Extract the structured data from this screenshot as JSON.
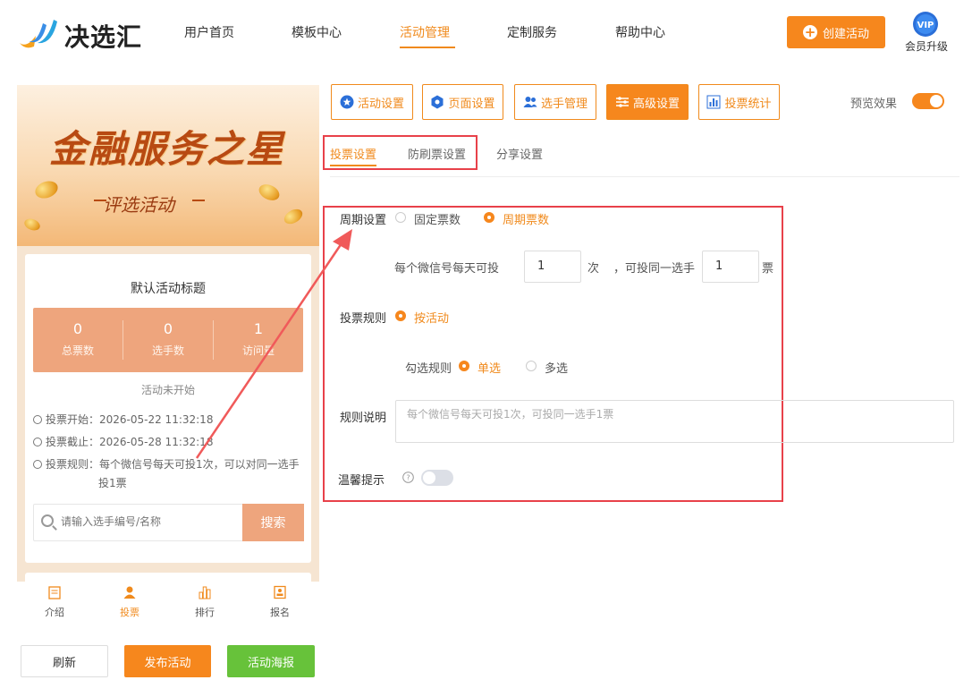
{
  "header": {
    "logo_text": "决选汇",
    "nav": [
      "用户首页",
      "模板中心",
      "活动管理",
      "定制服务",
      "帮助中心"
    ],
    "active_nav": "活动管理",
    "create_label": "创建活动",
    "vip_badge": "VIP",
    "vip_label": "会员升级",
    "accent_color": "#f6871d"
  },
  "phone": {
    "banner_title": "金融服务之星",
    "banner_sub": "评选活动",
    "card_title": "默认活动标题",
    "stats": [
      {
        "value": "0",
        "label": "总票数"
      },
      {
        "value": "0",
        "label": "选手数"
      },
      {
        "value": "1",
        "label": "访问量"
      }
    ],
    "status": "活动未开始",
    "start_line": "投票开始：2026-05-22 11:32:18",
    "end_line": "投票截止：2026-05-28 11:32:18",
    "rule_line1": "投票规则：每个微信号每天可投1次，可以对同一选手",
    "rule_line2": "投1票",
    "search_placeholder": "请输入选手编号/名称",
    "search_btn": "搜索",
    "tabbar": [
      {
        "label": "介绍",
        "icon": "doc-icon"
      },
      {
        "label": "投票",
        "icon": "person-icon"
      },
      {
        "label": "排行",
        "icon": "bars-icon"
      },
      {
        "label": "报名",
        "icon": "badge-icon"
      }
    ],
    "active_tab": "投票"
  },
  "bottom_buttons": {
    "refresh": "刷新",
    "publish": "发布活动",
    "poster": "活动海报"
  },
  "toolbar": {
    "buttons": [
      "活动设置",
      "页面设置",
      "选手管理",
      "高级设置",
      "投票统计"
    ],
    "active": "高级设置",
    "preview_label": "预览效果",
    "preview_on": true
  },
  "subtabs": [
    "投票设置",
    "防刷票设置",
    "分享设置"
  ],
  "active_subtab": "投票设置",
  "form": {
    "period_label": "周期设置",
    "period_options": [
      "固定票数",
      "周期票数"
    ],
    "period_selected": "周期票数",
    "per_day_prefix": "每个微信号每天可投",
    "per_day_value": "1",
    "per_day_unit": "次",
    "same_prefix": "，可投同一选手",
    "same_value": "1",
    "same_unit": "票",
    "rule_label": "投票规则",
    "rule_option": "按活动",
    "check_label": "勾选规则",
    "check_options": [
      "单选",
      "多选"
    ],
    "check_selected": "单选",
    "desc_label": "规则说明",
    "desc_value": "每个微信号每天可投1次，可投同一选手1票",
    "tip_label": "温馨提示",
    "tip_on": false
  }
}
